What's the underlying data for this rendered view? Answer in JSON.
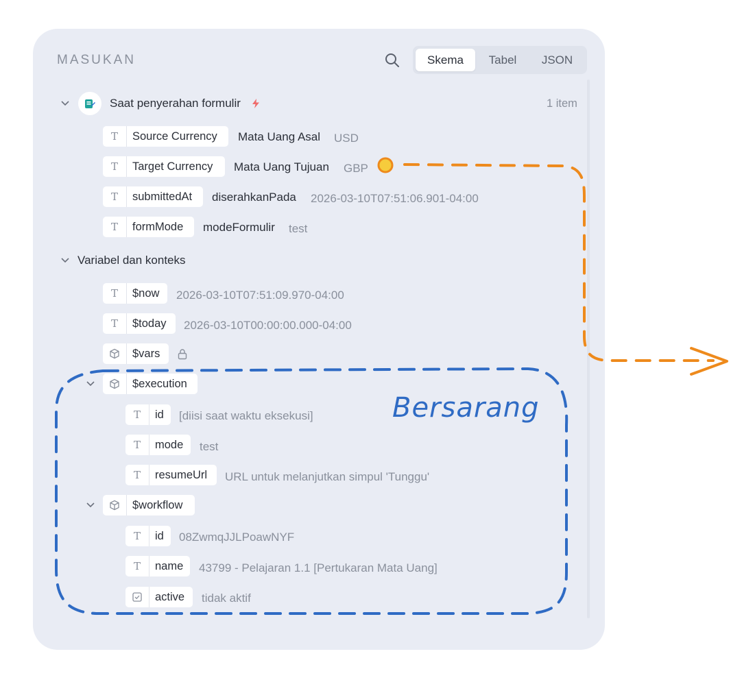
{
  "header": {
    "title": "MASUKAN",
    "tabs": [
      {
        "label": "Skema",
        "active": true
      },
      {
        "label": "Tabel",
        "active": false
      },
      {
        "label": "JSON",
        "active": false
      }
    ]
  },
  "trigger": {
    "title": "Saat penyerahan formulir",
    "count": "1 item",
    "fields": [
      {
        "label": "Source Currency",
        "key": "Mata Uang Asal",
        "value": "USD"
      },
      {
        "label": "Target Currency",
        "key": "Mata Uang Tujuan",
        "value": "GBP"
      },
      {
        "label": "submittedAt",
        "key": "diserahkanPada",
        "value": "2026-03-10T07:51:06.901-04:00"
      },
      {
        "label": "formMode",
        "key": "modeFormulir",
        "value": "test"
      }
    ]
  },
  "context": {
    "title": "Variabel dan konteks",
    "now": {
      "label": "$now",
      "value": "2026-03-10T07:51:09.970-04:00"
    },
    "today": {
      "label": "$today",
      "value": "2026-03-10T00:00:00.000-04:00"
    },
    "vars": {
      "label": "$vars"
    },
    "execution": {
      "label": "$execution",
      "fields": [
        {
          "label": "id",
          "value": "[diisi saat waktu eksekusi]"
        },
        {
          "label": "mode",
          "value": "test"
        },
        {
          "label": "resumeUrl",
          "value": "URL untuk melanjutkan simpul 'Tunggu'"
        }
      ]
    },
    "workflow": {
      "label": "$workflow",
      "fields": [
        {
          "label": "id",
          "value": "08ZwmqJJLPoawNYF"
        },
        {
          "label": "name",
          "value": "43799 - Pelajaran 1.1 [Pertukaran Mata Uang]"
        },
        {
          "label": "active",
          "value": "tidak aktif"
        }
      ]
    }
  },
  "annotation": {
    "text": "Bersarang"
  },
  "colors": {
    "accent_orange": "#ee8a1c",
    "annotation_blue": "#2f6bc4",
    "bolt": "#ef6b6b",
    "node_teal": "#1fa39b"
  }
}
